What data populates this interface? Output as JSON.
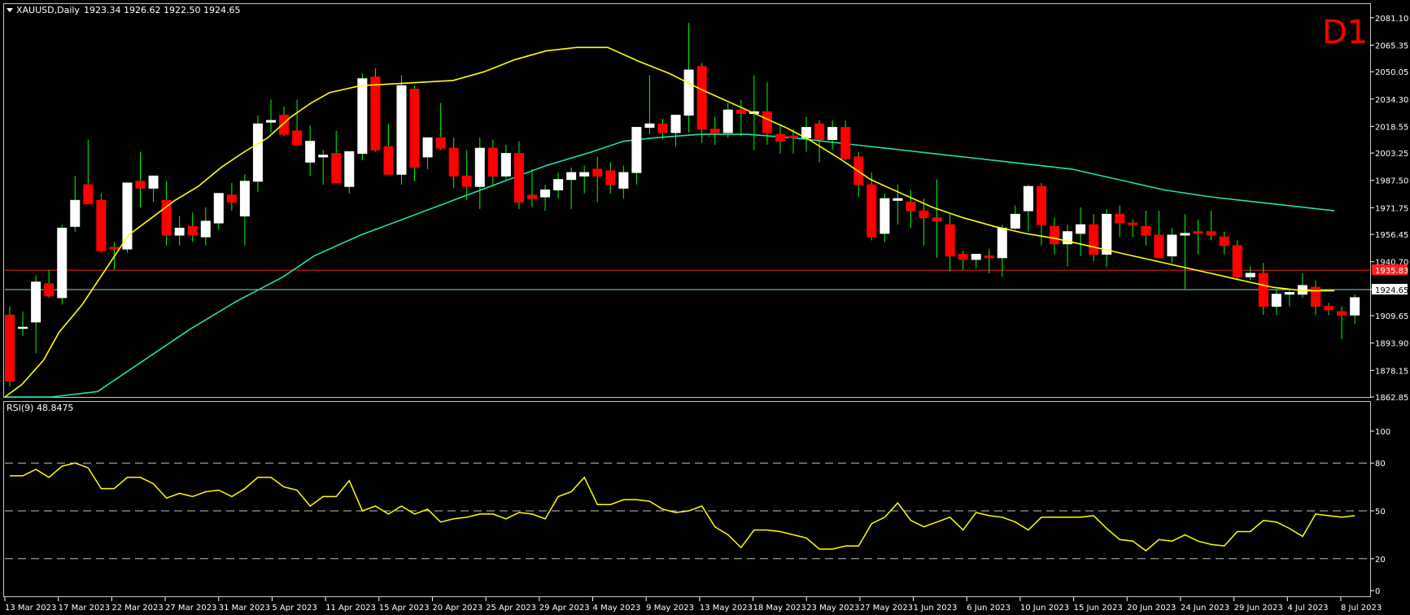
{
  "header": {
    "symbol_label": "XAUUSD,Daily",
    "ohlc_text": "1923.34 1926.62 1922.50 1924.65"
  },
  "timeframe_badge": "D1",
  "colors": {
    "background": "#000000",
    "bull_candle": "#ffffff",
    "bear_candle": "#ff0000",
    "wick": "#00ff00",
    "ma_fast": "#ffff00",
    "ma_slow": "#20e0b0",
    "rsi_line": "#ffff00",
    "h_line_red": "#ff2020",
    "h_line_bid": "#9ecfe0",
    "grid_dash": "#c0c0c0"
  },
  "chart_data": [
    {
      "type": "candlestick",
      "name": "XAUUSD,Daily",
      "ylim": [
        1862.85,
        2088.5
      ],
      "y_ticks": [
        "2081.10",
        "2065.35",
        "2050.05",
        "2034.30",
        "2018.55",
        "2003.25",
        "1987.50",
        "1971.75",
        "1956.45",
        "1940.70",
        "1924.65",
        "1909.65",
        "1893.90",
        "1878.15",
        "1862.85"
      ],
      "price_labels": [
        {
          "value": 1935.83,
          "text": "1935.83",
          "style": "red"
        },
        {
          "value": 1924.65,
          "text": "1924.65",
          "style": "current"
        }
      ],
      "x_labels": [
        "13 Mar 2023",
        "17 Mar 2023",
        "22 Mar 2023",
        "27 Mar 2023",
        "31 Mar 2023",
        "5 Apr 2023",
        "11 Apr 2023",
        "15 Apr 2023",
        "20 Apr 2023",
        "25 Apr 2023",
        "29 Apr 2023",
        "4 May 2023",
        "9 May 2023",
        "13 May 2023",
        "18 May 2023",
        "23 May 2023",
        "27 May 2023",
        "1 Jun 2023",
        "6 Jun 2023",
        "10 Jun 2023",
        "15 Jun 2023",
        "20 Jun 2023",
        "24 Jun 2023",
        "29 Jun 2023",
        "4 Jul 2023",
        "8 Jul 2023"
      ],
      "candles": [
        [
          1910,
          1915,
          1869,
          1872
        ],
        [
          1903,
          1912,
          1898,
          1903
        ],
        [
          1906,
          1933,
          1888,
          1929
        ],
        [
          1928,
          1936,
          1920,
          1921
        ],
        [
          1920,
          1962,
          1916,
          1960
        ],
        [
          1961,
          1990,
          1958,
          1976
        ],
        [
          1985,
          2011,
          1974,
          1974
        ],
        [
          1976,
          1980,
          1946,
          1947
        ],
        [
          1949,
          1952,
          1936,
          1948
        ],
        [
          1948,
          1984,
          1946,
          1986
        ],
        [
          1987,
          2004,
          1972,
          1983
        ],
        [
          1983,
          1988,
          1975,
          1990
        ],
        [
          1976,
          1987,
          1950,
          1956
        ],
        [
          1956,
          1967,
          1950,
          1960
        ],
        [
          1961,
          1969,
          1952,
          1956
        ],
        [
          1955,
          1972,
          1950,
          1964
        ],
        [
          1963,
          1980,
          1959,
          1980
        ],
        [
          1979,
          1986,
          1970,
          1975
        ],
        [
          1967,
          1991,
          1950,
          1987
        ],
        [
          1987,
          2025,
          1981,
          2020
        ],
        [
          2021,
          2034,
          2015,
          2022
        ],
        [
          2025,
          2030,
          2013,
          2014
        ],
        [
          2016,
          2034,
          2008,
          2008
        ],
        [
          1998,
          2019,
          1990,
          2010
        ],
        [
          2001,
          2005,
          1985,
          2002
        ],
        [
          2003,
          2016,
          1990,
          1986
        ],
        [
          1984,
          2004,
          1980,
          2004
        ],
        [
          2003,
          2049,
          1999,
          2046
        ],
        [
          2047,
          2052,
          2004,
          2005
        ],
        [
          2007,
          2020,
          1994,
          1991
        ],
        [
          1991,
          2048,
          1985,
          2042
        ],
        [
          2040,
          2042,
          1987,
          1995
        ],
        [
          2001,
          2012,
          1994,
          2012
        ],
        [
          2012,
          2032,
          2005,
          2006
        ],
        [
          2006,
          2012,
          1983,
          1990
        ],
        [
          1990,
          2005,
          1976,
          1984
        ],
        [
          1984,
          2012,
          1971,
          2006
        ],
        [
          2006,
          2011,
          1984,
          1990
        ],
        [
          1990,
          2008,
          1988,
          2003
        ],
        [
          2003,
          2010,
          1971,
          1975
        ],
        [
          1979,
          1994,
          1972,
          1977
        ],
        [
          1978,
          1985,
          1970,
          1982
        ],
        [
          1982,
          1992,
          1977,
          1988
        ],
        [
          1988,
          1995,
          1971,
          1992
        ],
        [
          1990,
          1996,
          1980,
          1992
        ],
        [
          1994,
          2001,
          1975,
          1990
        ],
        [
          1993,
          1998,
          1980,
          1985
        ],
        [
          1983,
          1996,
          1977,
          1992
        ],
        [
          1992,
          2018,
          1985,
          2018
        ],
        [
          2018,
          2048,
          2014,
          2020
        ],
        [
          2020,
          2023,
          2011,
          2015
        ],
        [
          2015,
          2022,
          2007,
          2025
        ],
        [
          2025,
          2078,
          2015,
          2051
        ],
        [
          2053,
          2055,
          2009,
          2017
        ],
        [
          2017,
          2024,
          2008,
          2015
        ],
        [
          2015,
          2032,
          2012,
          2028
        ],
        [
          2028,
          2034,
          2013,
          2026
        ],
        [
          2026,
          2048,
          2005,
          2027
        ],
        [
          2027,
          2044,
          2008,
          2015
        ],
        [
          2014,
          2020,
          2003,
          2010
        ],
        [
          2013,
          2017,
          2003,
          2012
        ],
        [
          2012,
          2024,
          2004,
          2018
        ],
        [
          2020,
          2022,
          1998,
          2011
        ],
        [
          2011,
          2022,
          2005,
          2018
        ],
        [
          2018,
          2022,
          1999,
          2000
        ],
        [
          2001,
          2004,
          1978,
          1985
        ],
        [
          1985,
          1992,
          1953,
          1955
        ],
        [
          1957,
          1980,
          1952,
          1977
        ],
        [
          1976,
          1985,
          1962,
          1977
        ],
        [
          1975,
          1982,
          1960,
          1970
        ],
        [
          1970,
          1977,
          1950,
          1966
        ],
        [
          1966,
          1988,
          1943,
          1964
        ],
        [
          1962,
          1968,
          1935,
          1944
        ],
        [
          1945,
          1947,
          1936,
          1942
        ],
        [
          1942,
          1945,
          1937,
          1945
        ],
        [
          1944,
          1948,
          1934,
          1943
        ],
        [
          1943,
          1962,
          1932,
          1960
        ],
        [
          1960,
          1973,
          1959,
          1968
        ],
        [
          1970,
          1985,
          1958,
          1984
        ],
        [
          1984,
          1986,
          1950,
          1962
        ],
        [
          1961,
          1966,
          1945,
          1951
        ],
        [
          1951,
          1962,
          1938,
          1958
        ],
        [
          1957,
          1972,
          1944,
          1962
        ],
        [
          1962,
          1968,
          1941,
          1945
        ],
        [
          1945,
          1971,
          1938,
          1968
        ],
        [
          1968,
          1973,
          1955,
          1963
        ],
        [
          1963,
          1965,
          1955,
          1962
        ],
        [
          1961,
          1970,
          1950,
          1956
        ],
        [
          1956,
          1970,
          1945,
          1943
        ],
        [
          1944,
          1960,
          1940,
          1956
        ],
        [
          1956,
          1968,
          1925,
          1957
        ],
        [
          1958,
          1965,
          1945,
          1957
        ],
        [
          1958,
          1970,
          1953,
          1956
        ],
        [
          1955,
          1958,
          1945,
          1950
        ],
        [
          1950,
          1953,
          1930,
          1932
        ],
        [
          1932,
          1938,
          1930,
          1934
        ],
        [
          1934,
          1940,
          1910,
          1915
        ],
        [
          1915,
          1925,
          1910,
          1922
        ],
        [
          1922,
          1925,
          1915,
          1923
        ],
        [
          1922,
          1934,
          1920,
          1927
        ],
        [
          1926,
          1930,
          1910,
          1915
        ],
        [
          1915,
          1917,
          1910,
          1913
        ],
        [
          1912,
          1915,
          1896,
          1910
        ],
        [
          1910,
          1922,
          1905,
          1920
        ],
        [
          1920,
          1925,
          1915,
          1921
        ],
        [
          1921,
          1930,
          1910,
          1928
        ],
        [
          1928,
          1930,
          1920,
          1928
        ],
        [
          1928,
          1935,
          1918,
          1924
        ],
        [
          1923,
          1927,
          1904,
          1914
        ],
        [
          1914,
          1935,
          1910,
          1932
        ],
        [
          1930,
          1933,
          1925,
          1929
        ],
        [
          1926,
          1929,
          1914,
          1925
        ],
        [
          1926,
          1926,
          1922,
          1924
        ]
      ],
      "ma_fast": [
        [
          0,
          1862
        ],
        [
          22,
          1870
        ],
        [
          50,
          1884
        ],
        [
          70,
          1900
        ],
        [
          100,
          1916
        ],
        [
          130,
          1936
        ],
        [
          160,
          1956
        ],
        [
          190,
          1966
        ],
        [
          220,
          1976
        ],
        [
          250,
          1984
        ],
        [
          280,
          1995
        ],
        [
          310,
          2004
        ],
        [
          340,
          2012
        ],
        [
          370,
          2024
        ],
        [
          396,
          2032
        ],
        [
          420,
          2038
        ],
        [
          460,
          2042
        ],
        [
          500,
          2043
        ],
        [
          540,
          2044
        ],
        [
          580,
          2045
        ],
        [
          620,
          2050
        ],
        [
          660,
          2057
        ],
        [
          700,
          2062
        ],
        [
          740,
          2064
        ],
        [
          780,
          2064
        ],
        [
          820,
          2056
        ],
        [
          860,
          2049
        ],
        [
          900,
          2040
        ],
        [
          940,
          2032
        ],
        [
          980,
          2024
        ],
        [
          1010,
          2018
        ],
        [
          1040,
          2011
        ],
        [
          1080,
          2000
        ],
        [
          1120,
          1988
        ],
        [
          1160,
          1980
        ],
        [
          1200,
          1972
        ],
        [
          1240,
          1966
        ],
        [
          1280,
          1961
        ],
        [
          1320,
          1957
        ],
        [
          1360,
          1954
        ],
        [
          1400,
          1950
        ],
        [
          1440,
          1946
        ],
        [
          1480,
          1942
        ],
        [
          1520,
          1938
        ],
        [
          1560,
          1934
        ],
        [
          1600,
          1930
        ],
        [
          1640,
          1926
        ],
        [
          1680,
          1924
        ],
        [
          1720,
          1924
        ]
      ],
      "ma_slow": [
        [
          0,
          1830
        ],
        [
          60,
          1848
        ],
        [
          120,
          1866
        ],
        [
          180,
          1884
        ],
        [
          240,
          1902
        ],
        [
          300,
          1918
        ],
        [
          360,
          1932
        ],
        [
          400,
          1944
        ],
        [
          460,
          1956
        ],
        [
          520,
          1966
        ],
        [
          580,
          1976
        ],
        [
          640,
          1986
        ],
        [
          700,
          1996
        ],
        [
          760,
          2004
        ],
        [
          800,
          2010
        ],
        [
          840,
          2012
        ],
        [
          900,
          2014
        ],
        [
          960,
          2014
        ],
        [
          1020,
          2012
        ],
        [
          1060,
          2010
        ],
        [
          1100,
          2008
        ],
        [
          1140,
          2006
        ],
        [
          1180,
          2004
        ],
        [
          1220,
          2002
        ],
        [
          1260,
          2000
        ],
        [
          1300,
          1998
        ],
        [
          1340,
          1996
        ],
        [
          1380,
          1994
        ],
        [
          1420,
          1990
        ],
        [
          1460,
          1986
        ],
        [
          1500,
          1982
        ],
        [
          1560,
          1978
        ],
        [
          1620,
          1975
        ],
        [
          1680,
          1972
        ],
        [
          1720,
          1970
        ]
      ]
    },
    {
      "type": "line",
      "name": "RSI(9) 48.8475",
      "ylim": [
        0,
        100
      ],
      "y_ticks": [
        "100",
        "80",
        "50",
        "20",
        "0"
      ],
      "dashed_levels": [
        80,
        50,
        20
      ],
      "values": [
        72,
        72,
        76,
        71,
        78,
        80,
        77,
        64,
        64,
        71,
        71,
        67,
        58,
        61,
        59,
        62,
        63,
        59,
        64,
        71,
        71,
        65,
        63,
        53,
        59,
        59,
        69,
        50,
        53,
        48,
        53,
        48,
        51,
        43,
        45,
        46,
        48,
        48,
        45,
        49,
        48,
        45,
        59,
        62,
        71,
        54,
        54,
        57,
        57,
        56,
        51,
        49,
        50,
        53,
        40,
        35,
        27,
        38,
        38,
        37,
        35,
        33,
        26,
        26,
        28,
        28,
        42,
        46,
        55,
        44,
        40,
        43,
        46,
        38,
        49,
        47,
        46,
        43,
        38,
        46,
        46,
        46,
        46,
        47,
        39,
        32,
        31,
        25,
        32,
        31,
        35,
        31,
        29,
        28,
        37,
        37,
        44,
        43,
        39,
        34,
        48,
        47,
        46,
        47
      ]
    }
  ]
}
